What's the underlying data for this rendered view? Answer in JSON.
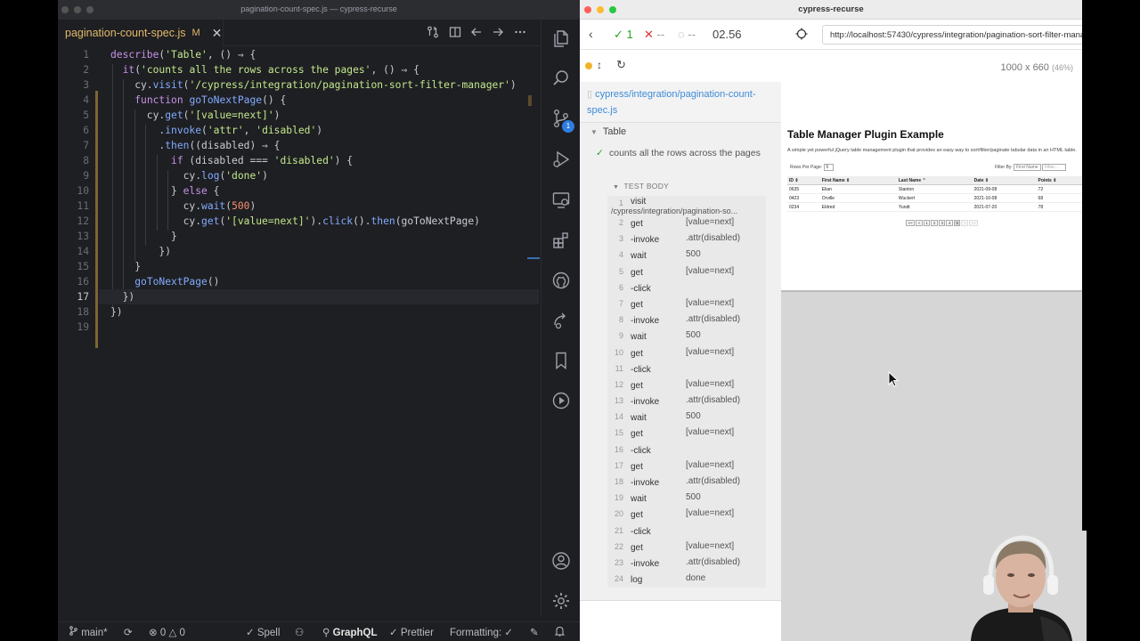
{
  "vscode": {
    "window_title": "pagination-count-spec.js — cypress-recurse",
    "tab": {
      "filename": "pagination-count-spec.js",
      "status": "M",
      "close": "✕"
    },
    "code": [
      {
        "n": "1",
        "text": "describe('Table', () ⇒ {"
      },
      {
        "n": "2",
        "text": "  it('counts all the rows across the pages', () ⇒ {"
      },
      {
        "n": "3",
        "text": "    cy.visit('/cypress/integration/pagination-sort-filter-manager')"
      },
      {
        "n": "4",
        "text": "    function goToNextPage() {"
      },
      {
        "n": "5",
        "text": "      cy.get('[value=next]')"
      },
      {
        "n": "6",
        "text": "        .invoke('attr', 'disabled')"
      },
      {
        "n": "7",
        "text": "        .then((disabled) ⇒ {"
      },
      {
        "n": "8",
        "text": "          if (disabled === 'disabled') {"
      },
      {
        "n": "9",
        "text": "            cy.log('done')"
      },
      {
        "n": "10",
        "text": "          } else {"
      },
      {
        "n": "11",
        "text": "            cy.wait(500)"
      },
      {
        "n": "12",
        "text": "            cy.get('[value=next]').click().then(goToNextPage)"
      },
      {
        "n": "13",
        "text": "          }"
      },
      {
        "n": "14",
        "text": "        })"
      },
      {
        "n": "15",
        "text": "    }"
      },
      {
        "n": "16",
        "text": "    goToNextPage()"
      },
      {
        "n": "17",
        "text": "  })"
      },
      {
        "n": "18",
        "text": "})"
      },
      {
        "n": "19",
        "text": ""
      }
    ],
    "activity_badge": "1",
    "status": {
      "branch": "main*",
      "errors": "0",
      "warnings": "0",
      "spell": "Spell",
      "graphql": "GraphQL",
      "prettier": "Prettier",
      "formatting": "Formatting: ✓"
    }
  },
  "cypress": {
    "window_title": "cypress-recurse",
    "passed": "1",
    "failed": "--",
    "pending": "--",
    "duration": "02.56",
    "url": "http://localhost:57430/cypress/integration/pagination-sort-filter-manager",
    "viewport": "1000 x 660",
    "viewport_scale": "(46%)",
    "spec_path": "cypress/integration/pagination-count-spec.js",
    "suite": "Table",
    "test": "counts all the rows across the pages",
    "test_body_label": "TEST BODY",
    "commands": [
      {
        "n": "1",
        "name": "visit",
        "msg": "/cypress/integration/pagination-so..."
      },
      {
        "n": "2",
        "name": "get",
        "msg": "[value=next]"
      },
      {
        "n": "3",
        "name": "-invoke",
        "msg": ".attr(disabled)"
      },
      {
        "n": "4",
        "name": "wait",
        "msg": "500"
      },
      {
        "n": "5",
        "name": "get",
        "msg": "[value=next]"
      },
      {
        "n": "6",
        "name": "-click",
        "msg": ""
      },
      {
        "n": "7",
        "name": "get",
        "msg": "[value=next]"
      },
      {
        "n": "8",
        "name": "-invoke",
        "msg": ".attr(disabled)"
      },
      {
        "n": "9",
        "name": "wait",
        "msg": "500"
      },
      {
        "n": "10",
        "name": "get",
        "msg": "[value=next]"
      },
      {
        "n": "11",
        "name": "-click",
        "msg": ""
      },
      {
        "n": "12",
        "name": "get",
        "msg": "[value=next]"
      },
      {
        "n": "13",
        "name": "-invoke",
        "msg": ".attr(disabled)"
      },
      {
        "n": "14",
        "name": "wait",
        "msg": "500"
      },
      {
        "n": "15",
        "name": "get",
        "msg": "[value=next]"
      },
      {
        "n": "16",
        "name": "-click",
        "msg": ""
      },
      {
        "n": "17",
        "name": "get",
        "msg": "[value=next]"
      },
      {
        "n": "18",
        "name": "-invoke",
        "msg": ".attr(disabled)"
      },
      {
        "n": "19",
        "name": "wait",
        "msg": "500"
      },
      {
        "n": "20",
        "name": "get",
        "msg": "[value=next]"
      },
      {
        "n": "21",
        "name": "-click",
        "msg": ""
      },
      {
        "n": "22",
        "name": "get",
        "msg": "[value=next]"
      },
      {
        "n": "23",
        "name": "-invoke",
        "msg": ".attr(disabled)"
      },
      {
        "n": "24",
        "name": "log",
        "msg": "done"
      }
    ],
    "app": {
      "title": "Table Manager Plugin Example",
      "description": "A simple yet powerful jQuery table management plugin that provides an easy way to sort/filter/paginate tabular data in an HTML table.",
      "rows_per_page_label": "Rows Per Page:",
      "rows_per_page_value": "5",
      "filter_label": "Filter By:",
      "filter_select": "First Name",
      "filter_placeholder": "Filter...",
      "headers": [
        "ID ⇕",
        "First Name ⇕",
        "Last Name ⌃",
        "Date ⇕",
        "Points ⇕"
      ],
      "rows": [
        [
          "0635",
          "Elian",
          "Stanton",
          "2021-09-08",
          "72"
        ],
        [
          "0423",
          "Orville",
          "Wuckert",
          "2021-10-08",
          "68"
        ],
        [
          "0234",
          "Eldred",
          "Yundt",
          "2021-07-20",
          "78"
        ]
      ],
      "pager": [
        "<<",
        "<",
        "1",
        "2",
        "3",
        "4",
        "5",
        ">",
        ">>"
      ]
    }
  }
}
